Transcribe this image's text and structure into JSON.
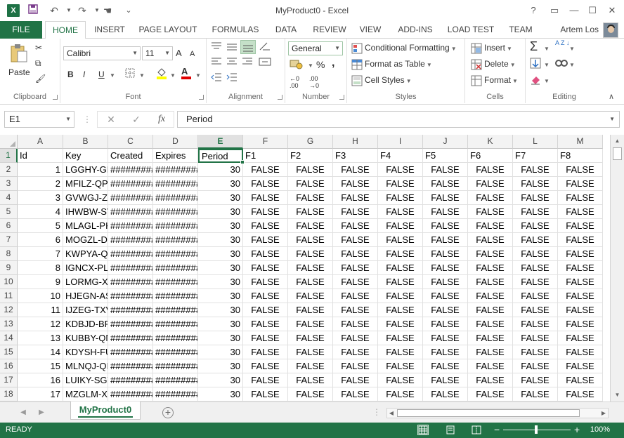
{
  "window": {
    "title": "MyProduct0 - Excel",
    "app_icon": "X",
    "controls": {
      "help": "?",
      "restore_ribbon": "▭",
      "minimize": "—",
      "maximize": "☐",
      "close": "✕"
    }
  },
  "quick_access": {
    "undo_icon": "↶",
    "redo_icon": "↷",
    "touch_icon": "☚",
    "customize_icon": "⌄"
  },
  "tabs": [
    {
      "label": "FILE"
    },
    {
      "label": "HOME"
    },
    {
      "label": "INSERT"
    },
    {
      "label": "PAGE LAYOUT"
    },
    {
      "label": "FORMULAS"
    },
    {
      "label": "DATA"
    },
    {
      "label": "REVIEW"
    },
    {
      "label": "VIEW"
    },
    {
      "label": "ADD-INS"
    },
    {
      "label": "LOAD TEST"
    },
    {
      "label": "TEAM"
    }
  ],
  "user": {
    "name": "Artem Los"
  },
  "ribbon": {
    "clipboard": {
      "label": "Clipboard",
      "paste": "Paste"
    },
    "font": {
      "label": "Font",
      "name": "Calibri",
      "size": "11",
      "bold": "B",
      "italic": "I",
      "underline": "U",
      "grow": "A",
      "shrink": "A",
      "fontcolor": "A"
    },
    "alignment": {
      "label": "Alignment"
    },
    "number": {
      "label": "Number",
      "format": "General",
      "percent": "%",
      "comma": ","
    },
    "styles": {
      "label": "Styles",
      "cond_format": "Conditional Formatting",
      "format_table": "Format as Table",
      "cell_styles": "Cell Styles"
    },
    "cells": {
      "label": "Cells",
      "insert": "Insert",
      "delete": "Delete",
      "format": "Format"
    },
    "editing": {
      "label": "Editing",
      "sum": "Σ",
      "sort": "A Z"
    }
  },
  "formula_bar": {
    "name_box": "E1",
    "cancel": "✕",
    "enter": "✓",
    "fx": "fx",
    "value": "Period"
  },
  "columns": [
    "A",
    "B",
    "C",
    "D",
    "E",
    "F",
    "G",
    "H",
    "I",
    "J",
    "K",
    "L",
    "M"
  ],
  "selected_cell": "E1",
  "rows": [
    [
      "Id",
      "Key",
      "Created",
      "Expires",
      "Period",
      "F1",
      "F2",
      "F3",
      "F4",
      "F5",
      "F6",
      "F7",
      "F8"
    ],
    [
      "1",
      "LGGHY-GF",
      "#########",
      "#########",
      "30",
      "FALSE",
      "FALSE",
      "FALSE",
      "FALSE",
      "FALSE",
      "FALSE",
      "FALSE",
      "FALSE"
    ],
    [
      "2",
      "MFILZ-QP",
      "#########",
      "#########",
      "30",
      "FALSE",
      "FALSE",
      "FALSE",
      "FALSE",
      "FALSE",
      "FALSE",
      "FALSE",
      "FALSE"
    ],
    [
      "3",
      "GVWGJ-ZV",
      "#########",
      "#########",
      "30",
      "FALSE",
      "FALSE",
      "FALSE",
      "FALSE",
      "FALSE",
      "FALSE",
      "FALSE",
      "FALSE"
    ],
    [
      "4",
      "IHWBW-SV",
      "#########",
      "#########",
      "30",
      "FALSE",
      "FALSE",
      "FALSE",
      "FALSE",
      "FALSE",
      "FALSE",
      "FALSE",
      "FALSE"
    ],
    [
      "5",
      "MLAGL-PK",
      "#########",
      "#########",
      "30",
      "FALSE",
      "FALSE",
      "FALSE",
      "FALSE",
      "FALSE",
      "FALSE",
      "FALSE",
      "FALSE"
    ],
    [
      "6",
      "MOGZL-D)",
      "#########",
      "#########",
      "30",
      "FALSE",
      "FALSE",
      "FALSE",
      "FALSE",
      "FALSE",
      "FALSE",
      "FALSE",
      "FALSE"
    ],
    [
      "7",
      "KWPYA-Q",
      "#########",
      "#########",
      "30",
      "FALSE",
      "FALSE",
      "FALSE",
      "FALSE",
      "FALSE",
      "FALSE",
      "FALSE",
      "FALSE"
    ],
    [
      "8",
      "IGNCX-PL",
      "#########",
      "#########",
      "30",
      "FALSE",
      "FALSE",
      "FALSE",
      "FALSE",
      "FALSE",
      "FALSE",
      "FALSE",
      "FALSE"
    ],
    [
      "9",
      "LORMG-XI",
      "#########",
      "#########",
      "30",
      "FALSE",
      "FALSE",
      "FALSE",
      "FALSE",
      "FALSE",
      "FALSE",
      "FALSE",
      "FALSE"
    ],
    [
      "10",
      "HJEGN-AS",
      "#########",
      "#########",
      "30",
      "FALSE",
      "FALSE",
      "FALSE",
      "FALSE",
      "FALSE",
      "FALSE",
      "FALSE",
      "FALSE"
    ],
    [
      "11",
      "IJZEG-TXV",
      "#########",
      "#########",
      "30",
      "FALSE",
      "FALSE",
      "FALSE",
      "FALSE",
      "FALSE",
      "FALSE",
      "FALSE",
      "FALSE"
    ],
    [
      "12",
      "KDBJD-BF",
      "#########",
      "#########",
      "30",
      "FALSE",
      "FALSE",
      "FALSE",
      "FALSE",
      "FALSE",
      "FALSE",
      "FALSE",
      "FALSE"
    ],
    [
      "13",
      "KUBBY-QN",
      "#########",
      "#########",
      "30",
      "FALSE",
      "FALSE",
      "FALSE",
      "FALSE",
      "FALSE",
      "FALSE",
      "FALSE",
      "FALSE"
    ],
    [
      "14",
      "KDYSH-FU",
      "#########",
      "#########",
      "30",
      "FALSE",
      "FALSE",
      "FALSE",
      "FALSE",
      "FALSE",
      "FALSE",
      "FALSE",
      "FALSE"
    ],
    [
      "15",
      "MLNQJ-QI",
      "#########",
      "#########",
      "30",
      "FALSE",
      "FALSE",
      "FALSE",
      "FALSE",
      "FALSE",
      "FALSE",
      "FALSE",
      "FALSE"
    ],
    [
      "16",
      "LUIKY-SGV",
      "#########",
      "#########",
      "30",
      "FALSE",
      "FALSE",
      "FALSE",
      "FALSE",
      "FALSE",
      "FALSE",
      "FALSE",
      "FALSE"
    ],
    [
      "17",
      "MZGLM-XA",
      "#########",
      "#########",
      "30",
      "FALSE",
      "FALSE",
      "FALSE",
      "FALSE",
      "FALSE",
      "FALSE",
      "FALSE",
      "FALSE"
    ]
  ],
  "sheet": {
    "active_tab": "MyProduct0",
    "add_icon": "+",
    "prev_icon": "◀",
    "next_icon": "▶"
  },
  "status": {
    "text": "READY",
    "zoom": "100%",
    "zoom_minus": "−",
    "zoom_plus": "+"
  },
  "colors": {
    "accent": "#217346",
    "grid_line": "#e1e1e1",
    "header_bg": "#f3f3f3"
  }
}
